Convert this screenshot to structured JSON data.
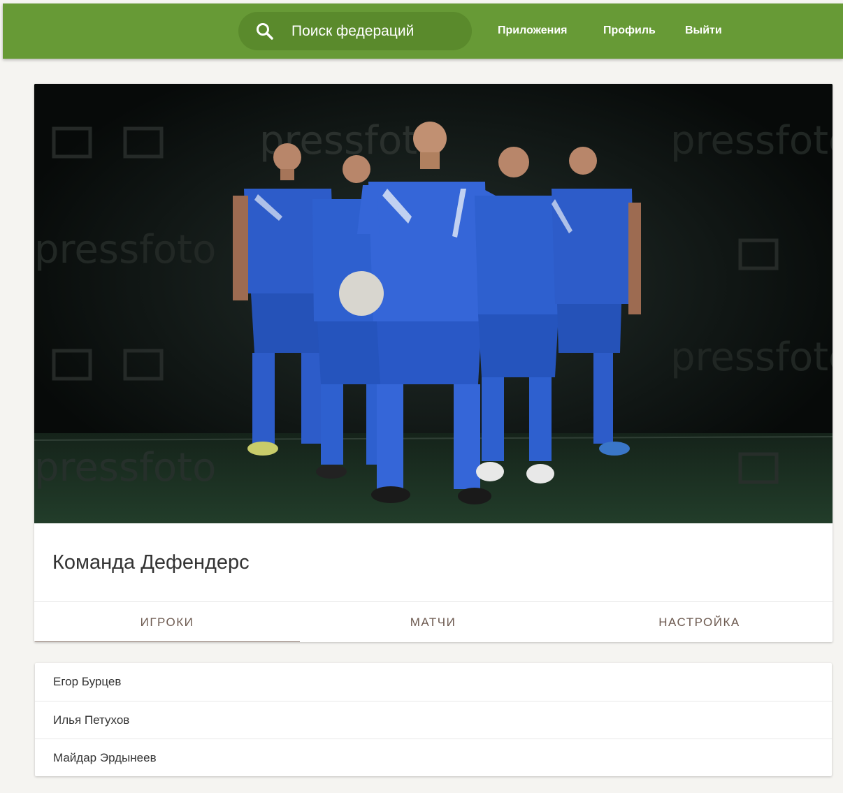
{
  "header": {
    "search_text": "Поиск федераций",
    "nav": {
      "apps": "Приложения",
      "profile": "Профиль",
      "logout": "Выйти"
    }
  },
  "team": {
    "title": "Команда Дефендерс",
    "hero_watermark": "pressfoto",
    "tabs": {
      "players": "ИГРОКИ",
      "matches": "МАТЧИ",
      "settings": "НАСТРОЙКА"
    },
    "active_tab": "ИГРОКИ"
  },
  "players": [
    {
      "name": "Егор Бурцев"
    },
    {
      "name": "Илья Петухов"
    },
    {
      "name": "Майдар Эрдынеев"
    }
  ],
  "colors": {
    "header_bg": "#679a36",
    "search_bg": "#5a8a2c",
    "page_bg": "#f5f4f1",
    "tab_text": "#6d5a50",
    "tab_indicator": "#8f7d74",
    "kit_blue": "#2f5fd0"
  },
  "icons": {
    "search": "search-icon"
  }
}
